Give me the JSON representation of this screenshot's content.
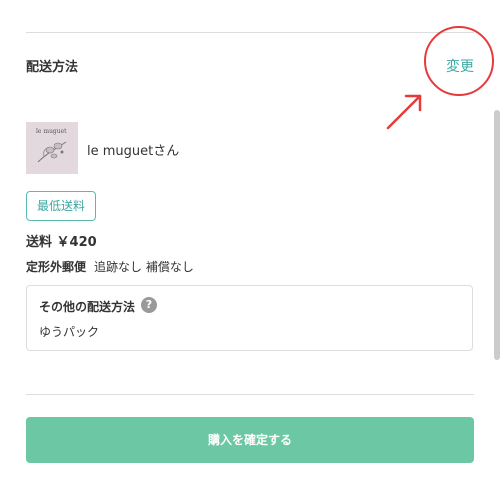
{
  "shipping": {
    "section_title": "配送方法",
    "change_label": "変更",
    "seller_name": "le muguetさん",
    "seller_thumb_text": "le muguet",
    "badge_label": "最低送料",
    "fee_text": "送料 ￥420",
    "method_name": "定形外郵便",
    "method_note": "追跡なし 補償なし"
  },
  "other_methods": {
    "title": "その他の配送方法",
    "help_symbol": "?",
    "value": "ゆうパック"
  },
  "actions": {
    "confirm_label": "購入を確定する"
  },
  "colors": {
    "accent": "#3da7a3",
    "button": "#6cc7a4",
    "annotation": "#e63b3b",
    "help_icon": "#999999"
  },
  "icons": {
    "help": "question-circle-icon",
    "annotation_arrow": "arrow-icon"
  }
}
